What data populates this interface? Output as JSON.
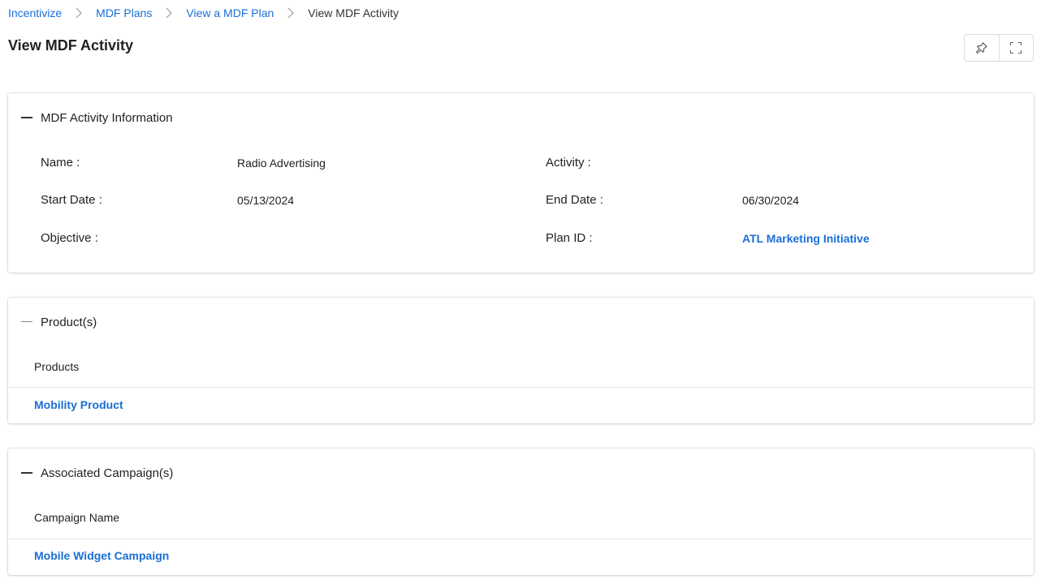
{
  "breadcrumb": {
    "items": [
      "Incentivize",
      "MDF Plans",
      "View a MDF Plan"
    ],
    "current": "View MDF Activity"
  },
  "page": {
    "title": "View MDF Activity"
  },
  "toolbar": {
    "pin_icon": "pin-icon",
    "fullscreen_icon": "fullscreen-icon"
  },
  "activity_info": {
    "title": "MDF Activity Information",
    "fields": {
      "name_label": "Name :",
      "name_value": "Radio Advertising",
      "activity_label": "Activity :",
      "activity_value": "",
      "start_label": "Start Date :",
      "start_value": "05/13/2024",
      "end_label": "End Date :",
      "end_value": "06/30/2024",
      "objective_label": "Objective :",
      "objective_value": "",
      "plan_label": "Plan ID :",
      "plan_value": "ATL Marketing Initiative"
    }
  },
  "products": {
    "title": "Product(s)",
    "column": "Products",
    "rows": [
      "Mobility Product"
    ]
  },
  "campaigns": {
    "title": "Associated Campaign(s)",
    "column": "Campaign Name",
    "rows": [
      "Mobile Widget Campaign"
    ]
  },
  "colors": {
    "link": "#1a6fd6",
    "text": "#222222",
    "border": "#dcdcdc"
  }
}
